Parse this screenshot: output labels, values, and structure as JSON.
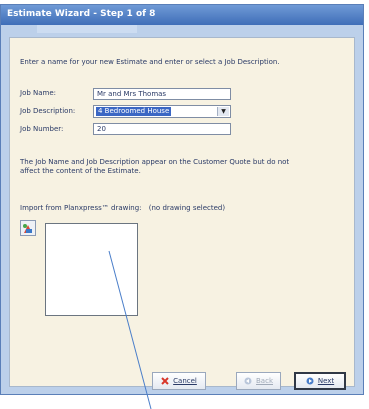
{
  "window": {
    "title": "Estimate Wizard - Step 1 of 8"
  },
  "intro": "Enter a name for your new Estimate and enter or select a Job Description.",
  "fields": {
    "job_name": {
      "label": "Job Name:",
      "value": "Mr and Mrs Thomas"
    },
    "job_description": {
      "label": "Job Description:",
      "value": "4 Bedroomed House"
    },
    "job_number": {
      "label": "Job Number:",
      "value": "20"
    }
  },
  "note": {
    "line1": "The Job Name and Job Description appear on the Customer Quote but do not",
    "line2": "affect the content of the Estimate."
  },
  "import": {
    "label": "Import from Planxpress™ drawing:",
    "status": "(no drawing selected)"
  },
  "buttons": {
    "cancel": "Cancel",
    "back": "Back",
    "next": "Next"
  },
  "colors": {
    "title_bar": "#4f7dc4",
    "dialog_bg": "#bcd0ea",
    "panel_bg": "#f7f2e2",
    "selection": "#3b67c4",
    "pointer_line": "#4a7ec9",
    "cancel_icon": "#d8372a"
  },
  "icons": {
    "import": "import-drawing-icon",
    "cancel": "cancel-x-icon",
    "back": "back-arrow-icon",
    "next": "next-arrow-icon"
  }
}
